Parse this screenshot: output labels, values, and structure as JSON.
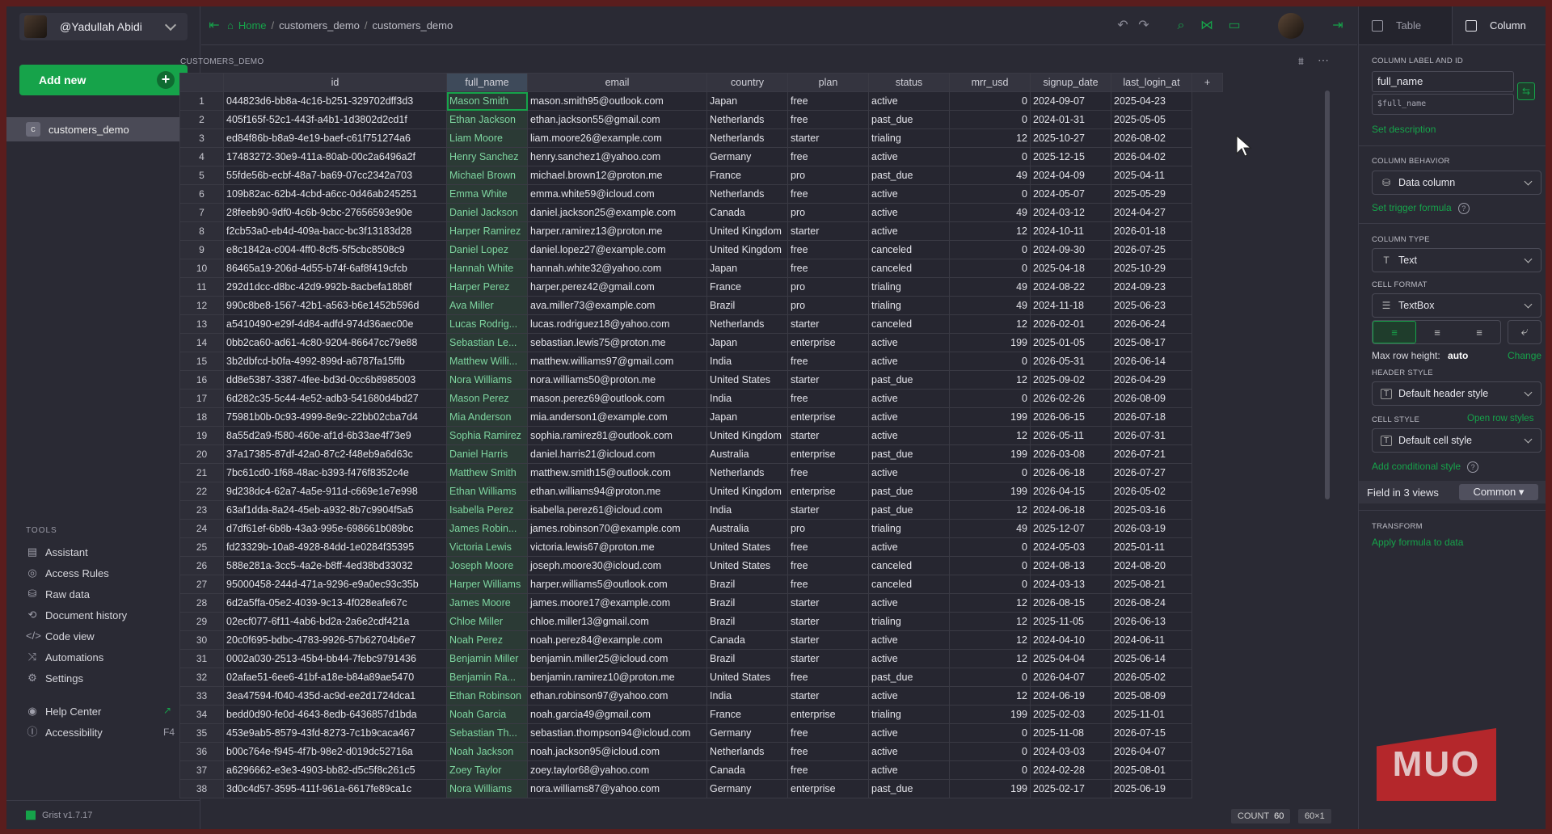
{
  "user": {
    "name": "@Yadullah Abidi"
  },
  "add_new": "Add new",
  "doc": {
    "badge": "c",
    "name": "customers_demo"
  },
  "tools": {
    "heading": "TOOLS",
    "items": [
      "Assistant",
      "Access Rules",
      "Raw data",
      "Document history",
      "Code view",
      "Automations",
      "Settings"
    ],
    "help": "Help Center",
    "accessibility": "Accessibility",
    "accessibility_key": "F4"
  },
  "version": "Grist v1.7.17",
  "breadcrumb": {
    "home": "Home",
    "doc": "customers_demo",
    "page": "customers_demo"
  },
  "section_title": "CUSTOMERS_DEMO",
  "columns": [
    "id",
    "full_name",
    "email",
    "country",
    "plan",
    "status",
    "mrr_usd",
    "signup_date",
    "last_login_at",
    "+"
  ],
  "rows": [
    [
      "1",
      "044823d6-bb8a-4c16-b251-329702dff3d3",
      "Mason Smith",
      "mason.smith95@outlook.com",
      "Japan",
      "free",
      "active",
      "0",
      "2024-09-07",
      "2025-04-23"
    ],
    [
      "2",
      "405f165f-52c1-443f-a4b1-1d3802d2cd1f",
      "Ethan Jackson",
      "ethan.jackson55@gmail.com",
      "Netherlands",
      "free",
      "past_due",
      "0",
      "2024-01-31",
      "2025-05-05"
    ],
    [
      "3",
      "ed84f86b-b8a9-4e19-baef-c61f751274a6",
      "Liam Moore",
      "liam.moore26@example.com",
      "Netherlands",
      "starter",
      "trialing",
      "12",
      "2025-10-27",
      "2026-08-02"
    ],
    [
      "4",
      "17483272-30e9-411a-80ab-00c2a6496a2f",
      "Henry Sanchez",
      "henry.sanchez1@yahoo.com",
      "Germany",
      "free",
      "active",
      "0",
      "2025-12-15",
      "2026-04-02"
    ],
    [
      "5",
      "55fde56b-ecbf-48a7-ba69-07cc2342a703",
      "Michael Brown",
      "michael.brown12@proton.me",
      "France",
      "pro",
      "past_due",
      "49",
      "2024-04-09",
      "2025-04-11"
    ],
    [
      "6",
      "109b82ac-62b4-4cbd-a6cc-0d46ab245251",
      "Emma White",
      "emma.white59@icloud.com",
      "Netherlands",
      "free",
      "active",
      "0",
      "2024-05-07",
      "2025-05-29"
    ],
    [
      "7",
      "28feeb90-9df0-4c6b-9cbc-27656593e90e",
      "Daniel Jackson",
      "daniel.jackson25@example.com",
      "Canada",
      "pro",
      "active",
      "49",
      "2024-03-12",
      "2024-04-27"
    ],
    [
      "8",
      "f2cb53a0-eb4d-409a-bacc-bc3f13183d28",
      "Harper Ramirez",
      "harper.ramirez13@proton.me",
      "United Kingdom",
      "starter",
      "active",
      "12",
      "2024-10-11",
      "2026-01-18"
    ],
    [
      "9",
      "e8c1842a-c004-4ff0-8cf5-5f5cbc8508c9",
      "Daniel Lopez",
      "daniel.lopez27@example.com",
      "United Kingdom",
      "free",
      "canceled",
      "0",
      "2024-09-30",
      "2026-07-25"
    ],
    [
      "10",
      "86465a19-206d-4d55-b74f-6af8f419cfcb",
      "Hannah White",
      "hannah.white32@yahoo.com",
      "Japan",
      "free",
      "canceled",
      "0",
      "2025-04-18",
      "2025-10-29"
    ],
    [
      "11",
      "292d1dcc-d8bc-42d9-992b-8acbefa18b8f",
      "Harper Perez",
      "harper.perez42@gmail.com",
      "France",
      "pro",
      "trialing",
      "49",
      "2024-08-22",
      "2024-09-23"
    ],
    [
      "12",
      "990c8be8-1567-42b1-a563-b6e1452b596d",
      "Ava Miller",
      "ava.miller73@example.com",
      "Brazil",
      "pro",
      "trialing",
      "49",
      "2024-11-18",
      "2025-06-23"
    ],
    [
      "13",
      "a5410490-e29f-4d84-adfd-974d36aec00e",
      "Lucas Rodrig...",
      "lucas.rodriguez18@yahoo.com",
      "Netherlands",
      "starter",
      "canceled",
      "12",
      "2026-02-01",
      "2026-06-24"
    ],
    [
      "14",
      "0bb2ca60-ad61-4c80-9204-86647cc79e88",
      "Sebastian Le...",
      "sebastian.lewis75@proton.me",
      "Japan",
      "enterprise",
      "active",
      "199",
      "2025-01-05",
      "2025-08-17"
    ],
    [
      "15",
      "3b2dbfcd-b0fa-4992-899d-a6787fa15ffb",
      "Matthew Willi...",
      "matthew.williams97@gmail.com",
      "India",
      "free",
      "active",
      "0",
      "2026-05-31",
      "2026-06-14"
    ],
    [
      "16",
      "dd8e5387-3387-4fee-bd3d-0cc6b8985003",
      "Nora Williams",
      "nora.williams50@proton.me",
      "United States",
      "starter",
      "past_due",
      "12",
      "2025-09-02",
      "2026-04-29"
    ],
    [
      "17",
      "6d282c35-5c44-4e52-adb3-541680d4bd27",
      "Mason Perez",
      "mason.perez69@outlook.com",
      "India",
      "free",
      "active",
      "0",
      "2026-02-26",
      "2026-08-09"
    ],
    [
      "18",
      "75981b0b-0c93-4999-8e9c-22bb02cba7d4",
      "Mia Anderson",
      "mia.anderson1@example.com",
      "Japan",
      "enterprise",
      "active",
      "199",
      "2026-06-15",
      "2026-07-18"
    ],
    [
      "19",
      "8a55d2a9-f580-460e-af1d-6b33ae4f73e9",
      "Sophia Ramirez",
      "sophia.ramirez81@outlook.com",
      "United Kingdom",
      "starter",
      "active",
      "12",
      "2026-05-11",
      "2026-07-31"
    ],
    [
      "20",
      "37a17385-87df-42a0-87c2-f48eb9a6d63c",
      "Daniel Harris",
      "daniel.harris21@icloud.com",
      "Australia",
      "enterprise",
      "past_due",
      "199",
      "2026-03-08",
      "2026-07-21"
    ],
    [
      "21",
      "7bc61cd0-1f68-48ac-b393-f476f8352c4e",
      "Matthew Smith",
      "matthew.smith15@outlook.com",
      "Netherlands",
      "free",
      "active",
      "0",
      "2026-06-18",
      "2026-07-27"
    ],
    [
      "22",
      "9d238dc4-62a7-4a5e-911d-c669e1e7e998",
      "Ethan Williams",
      "ethan.williams94@proton.me",
      "United Kingdom",
      "enterprise",
      "past_due",
      "199",
      "2026-04-15",
      "2026-05-02"
    ],
    [
      "23",
      "63af1dda-8a24-45eb-a932-8b7c9904f5a5",
      "Isabella Perez",
      "isabella.perez61@icloud.com",
      "India",
      "starter",
      "past_due",
      "12",
      "2024-06-18",
      "2025-03-16"
    ],
    [
      "24",
      "d7df61ef-6b8b-43a3-995e-698661b089bc",
      "James Robin...",
      "james.robinson70@example.com",
      "Australia",
      "pro",
      "trialing",
      "49",
      "2025-12-07",
      "2026-03-19"
    ],
    [
      "25",
      "fd23329b-10a8-4928-84dd-1e0284f35395",
      "Victoria Lewis",
      "victoria.lewis67@proton.me",
      "United States",
      "free",
      "active",
      "0",
      "2024-05-03",
      "2025-01-11"
    ],
    [
      "26",
      "588e281a-3cc5-4a2e-b8ff-4ed38bd33032",
      "Joseph Moore",
      "joseph.moore30@icloud.com",
      "United States",
      "free",
      "canceled",
      "0",
      "2024-08-13",
      "2024-08-20"
    ],
    [
      "27",
      "95000458-244d-471a-9296-e9a0ec93c35b",
      "Harper Williams",
      "harper.williams5@outlook.com",
      "Brazil",
      "free",
      "canceled",
      "0",
      "2024-03-13",
      "2025-08-21"
    ],
    [
      "28",
      "6d2a5ffa-05e2-4039-9c13-4f028eafe67c",
      "James Moore",
      "james.moore17@example.com",
      "Brazil",
      "starter",
      "active",
      "12",
      "2026-08-15",
      "2026-08-24"
    ],
    [
      "29",
      "02ecf077-6f11-4ab6-bd2a-2a6e2cdf421a",
      "Chloe Miller",
      "chloe.miller13@gmail.com",
      "Brazil",
      "starter",
      "trialing",
      "12",
      "2025-11-05",
      "2026-06-13"
    ],
    [
      "30",
      "20c0f695-bdbc-4783-9926-57b62704b6e7",
      "Noah Perez",
      "noah.perez84@example.com",
      "Canada",
      "starter",
      "active",
      "12",
      "2024-04-10",
      "2024-06-11"
    ],
    [
      "31",
      "0002a030-2513-45b4-bb44-7febc9791436",
      "Benjamin Miller",
      "benjamin.miller25@icloud.com",
      "Brazil",
      "starter",
      "active",
      "12",
      "2025-04-04",
      "2025-06-14"
    ],
    [
      "32",
      "02afae51-6ee6-41bf-a18e-b84a89ae5470",
      "Benjamin Ra...",
      "benjamin.ramirez10@proton.me",
      "United States",
      "free",
      "past_due",
      "0",
      "2026-04-07",
      "2026-05-02"
    ],
    [
      "33",
      "3ea47594-f040-435d-ac9d-ee2d1724dca1",
      "Ethan Robinson",
      "ethan.robinson97@yahoo.com",
      "India",
      "starter",
      "active",
      "12",
      "2024-06-19",
      "2025-08-09"
    ],
    [
      "34",
      "bedd0d90-fe0d-4643-8edb-6436857d1bda",
      "Noah Garcia",
      "noah.garcia49@gmail.com",
      "France",
      "enterprise",
      "trialing",
      "199",
      "2025-02-03",
      "2025-11-01"
    ],
    [
      "35",
      "453e9ab5-8579-43fd-8273-7c1b9caca467",
      "Sebastian Th...",
      "sebastian.thompson94@icloud.com",
      "Germany",
      "free",
      "active",
      "0",
      "2025-11-08",
      "2026-07-15"
    ],
    [
      "36",
      "b00c764e-f945-4f7b-98e2-d019dc52716a",
      "Noah Jackson",
      "noah.jackson95@icloud.com",
      "Netherlands",
      "free",
      "active",
      "0",
      "2024-03-03",
      "2026-04-07"
    ],
    [
      "37",
      "a6296662-e3e3-4903-bb82-d5c5f8c261c5",
      "Zoey Taylor",
      "zoey.taylor68@yahoo.com",
      "Canada",
      "free",
      "active",
      "0",
      "2024-02-28",
      "2025-08-01"
    ],
    [
      "38",
      "3d0c4d57-3595-411f-961a-6617fe89ca1c",
      "Nora Williams",
      "nora.williams87@yahoo.com",
      "Germany",
      "enterprise",
      "past_due",
      "199",
      "2025-02-17",
      "2025-06-19"
    ]
  ],
  "footer": {
    "count_label": "COUNT",
    "count_value": "60",
    "dims": "60×1"
  },
  "right": {
    "tab_table": "Table",
    "tab_column": "Column",
    "column_label_h": "COLUMN LABEL AND ID",
    "column_label": "full_name",
    "column_id": "$full_name",
    "set_description": "Set description",
    "behavior_h": "COLUMN BEHAVIOR",
    "behavior": "Data column",
    "trigger": "Set trigger formula",
    "type_h": "COLUMN TYPE",
    "type": "Text",
    "format_h": "CELL FORMAT",
    "format": "TextBox",
    "max_row_label": "Max row height:",
    "max_row_value": "auto",
    "change": "Change",
    "header_style_h": "HEADER STYLE",
    "header_style": "Default header style",
    "cell_style_h": "CELL STYLE",
    "open_row_styles": "Open row styles",
    "cell_style": "Default cell style",
    "add_conditional": "Add conditional style",
    "field_views": "Field in 3 views",
    "common": "Common",
    "transform_h": "TRANSFORM",
    "apply_formula": "Apply formula to data"
  },
  "watermark": "MUO",
  "colors": {
    "accent": "#16a34a",
    "bg": "#2a2a34",
    "frame": "#5a1d1d"
  }
}
